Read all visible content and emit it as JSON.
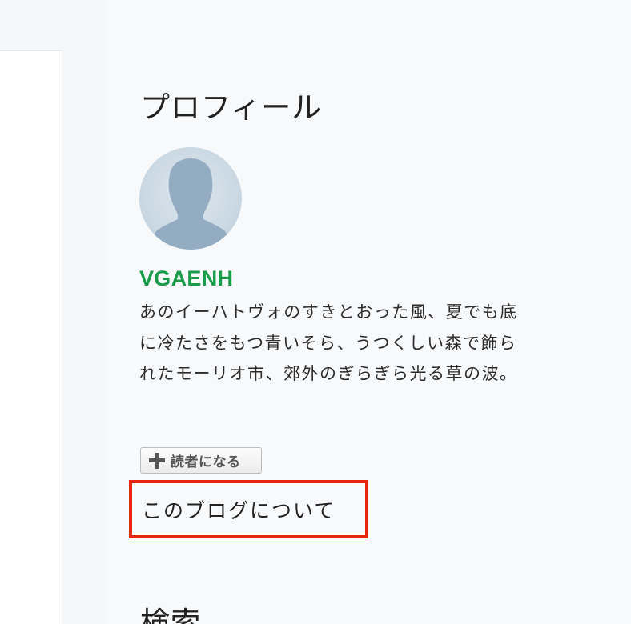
{
  "sidebar": {
    "profile": {
      "title": "プロフィール",
      "avatar_icon": "user-silhouette-icon",
      "username": "VGAENH",
      "bio": "あのイーハトヴォのすきとおった風、夏でも底に冷たさをもつ青いそら、うつくしい森で飾られたモーリオ市、郊外のぎらぎら光る草の波。",
      "reader_button_label": "読者になる",
      "reader_button_icon": "plus-icon",
      "about_link_label": "このブログについて"
    },
    "search": {
      "title": "検索"
    }
  },
  "colors": {
    "username": "#1a9b4a",
    "highlight_box": "#e8260b",
    "sidebar_bg": "#f8f9fb"
  }
}
